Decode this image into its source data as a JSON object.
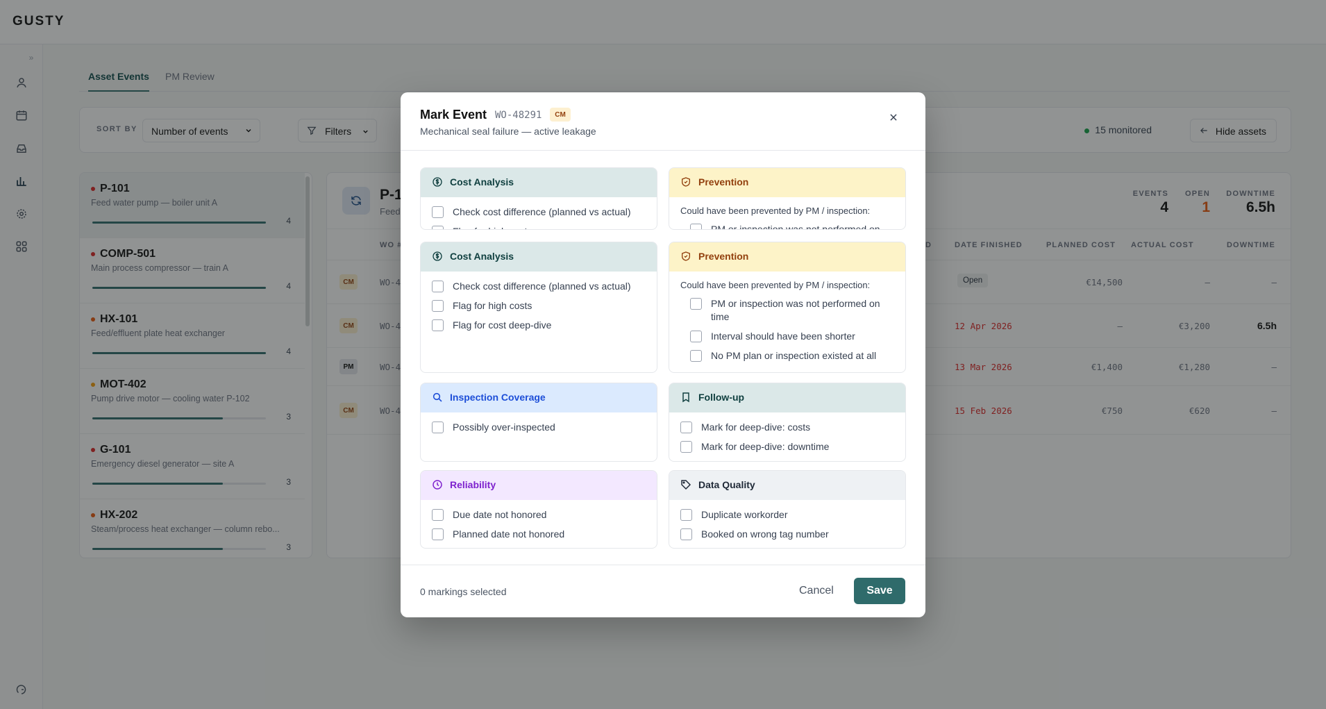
{
  "app": {
    "logo": "GUSTY"
  },
  "tabs": [
    {
      "label": "Asset Events"
    },
    {
      "label": "PM Review"
    }
  ],
  "toolbar": {
    "sort_label": "SORT BY",
    "sort_value": "Number of events",
    "filters_label": "Filters",
    "monitored": "15 monitored",
    "hide_assets": "Hide assets"
  },
  "assets": [
    {
      "tag": "P-101",
      "desc": "Feed water pump — boiler unit A",
      "count": "4",
      "fill": 1.0,
      "dot": "#dc2626"
    },
    {
      "tag": "COMP-501",
      "desc": "Main process compressor — train A",
      "count": "4",
      "fill": 1.0,
      "dot": "#dc2626"
    },
    {
      "tag": "HX-101",
      "desc": "Feed/effluent plate heat exchanger",
      "count": "4",
      "fill": 1.0,
      "dot": "#ea580c"
    },
    {
      "tag": "MOT-402",
      "desc": "Pump drive motor — cooling water P-102",
      "count": "3",
      "fill": 0.75,
      "dot": "#f59e0b"
    },
    {
      "tag": "G-101",
      "desc": "Emergency diesel generator — site A",
      "count": "3",
      "fill": 0.75,
      "dot": "#dc2626"
    },
    {
      "tag": "HX-202",
      "desc": "Steam/process heat exchanger — column rebo...",
      "count": "3",
      "fill": 0.75,
      "dot": "#ea580c"
    }
  ],
  "detail": {
    "title": "P-1(",
    "subtitle": "Feed",
    "kpis": [
      {
        "label": "EVENTS",
        "value": "4",
        "color": "#111111"
      },
      {
        "label": "OPEN",
        "value": "1",
        "color": "#ea580c"
      },
      {
        "label": "DOWNTIME",
        "value": "6.5h",
        "color": "#111111"
      }
    ],
    "columns": [
      "WO #",
      "D",
      "DATE FINISHED",
      "PLANNED COST",
      "ACTUAL COST",
      "DOWNTIME"
    ],
    "rows": [
      {
        "type": "CM",
        "wo": "WO-48",
        "date": "Open",
        "planned": "€14,500",
        "actual": "—",
        "downtime": "—"
      },
      {
        "type": "CM",
        "wo": "WO-48",
        "date": "12 Apr 2026",
        "planned": "—",
        "actual": "€3,200",
        "downtime": "6.5h"
      },
      {
        "type": "PM",
        "wo": "WO-47",
        "date": "13 Mar 2026",
        "planned": "€1,400",
        "actual": "€1,280",
        "downtime": "—"
      },
      {
        "type": "CM",
        "wo": "WO-46",
        "date": "15 Feb 2026",
        "planned": "€750",
        "actual": "€620",
        "downtime": "—"
      }
    ]
  },
  "modal": {
    "title": "Mark Event",
    "wo": "WO-48291",
    "badge": "CM",
    "subtitle": "Mechanical seal failure — active leakage",
    "cost_header": "Cost Analysis",
    "cost_items": [
      "Check cost difference (planned vs actual)",
      "Flag for high costs",
      "Flag for cost deep-dive"
    ],
    "prev_header": "Prevention",
    "prev_note": "Could have been prevented by PM / inspection:",
    "prev_items": [
      "PM or inspection was not performed on time",
      "Interval should have been shorter",
      "No PM plan or inspection existed at all"
    ],
    "insp_header": "Inspection Coverage",
    "insp_items": [
      "Possibly over-inspected"
    ],
    "follow_header": "Follow-up",
    "follow_items": [
      "Mark for deep-dive: costs",
      "Mark for deep-dive: downtime"
    ],
    "rel_header": "Reliability",
    "rel_items": [
      "Due date not honored",
      "Planned date not honored"
    ],
    "dq_header": "Data Quality",
    "dq_items": [
      "Duplicate workorder",
      "Booked on wrong tag number"
    ],
    "selected": "0 markings selected",
    "cancel": "Cancel",
    "save": "Save"
  }
}
